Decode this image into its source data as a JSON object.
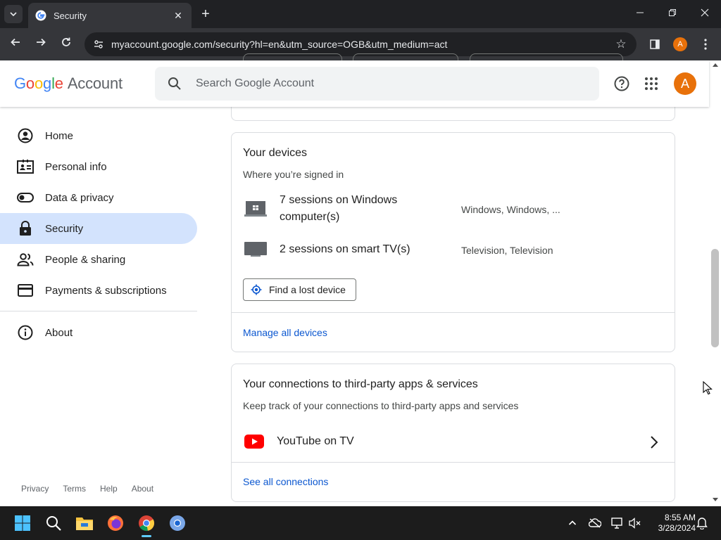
{
  "browser": {
    "tab_title": "Security",
    "url": "myaccount.google.com/security?hl=en&utm_source=OGB&utm_medium=act",
    "profile_initial": "A"
  },
  "header": {
    "logo_letters": [
      "G",
      "o",
      "o",
      "g",
      "l",
      "e"
    ],
    "logo_suffix": "Account",
    "search_placeholder": "Search Google Account",
    "avatar_initial": "A"
  },
  "sidebar": {
    "items": [
      {
        "label": "Home",
        "icon": "account-circle-icon"
      },
      {
        "label": "Personal info",
        "icon": "id-card-icon"
      },
      {
        "label": "Data & privacy",
        "icon": "toggle-icon"
      },
      {
        "label": "Security",
        "icon": "lock-icon",
        "active": true
      },
      {
        "label": "People & sharing",
        "icon": "people-icon"
      },
      {
        "label": "Payments & subscriptions",
        "icon": "credit-card-icon"
      },
      {
        "label": "About",
        "icon": "info-icon"
      }
    ],
    "footer": [
      "Privacy",
      "Terms",
      "Help",
      "About"
    ]
  },
  "devices_card": {
    "title": "Your devices",
    "subtitle": "Where you’re signed in",
    "rows": [
      {
        "text": "7 sessions on Windows computer(s)",
        "meta": "Windows, Windows, ...",
        "icon": "windows-laptop-icon"
      },
      {
        "text": "2 sessions on smart TV(s)",
        "meta": "Television, Television",
        "icon": "tv-icon"
      }
    ],
    "find_button": "Find a lost device",
    "manage_link": "Manage all devices"
  },
  "connections_card": {
    "title": "Your connections to third-party apps & services",
    "subtitle": "Keep track of your connections to third-party apps and services",
    "rows": [
      {
        "text": "YouTube on TV",
        "icon": "youtube-icon"
      }
    ],
    "see_all_link": "See all connections"
  },
  "taskbar": {
    "time": "8:55 AM",
    "date": "3/28/2024"
  },
  "colors": {
    "accent_blue": "#0b57d0",
    "active_nav": "#d3e3fd",
    "avatar_orange": "#e8710a"
  }
}
